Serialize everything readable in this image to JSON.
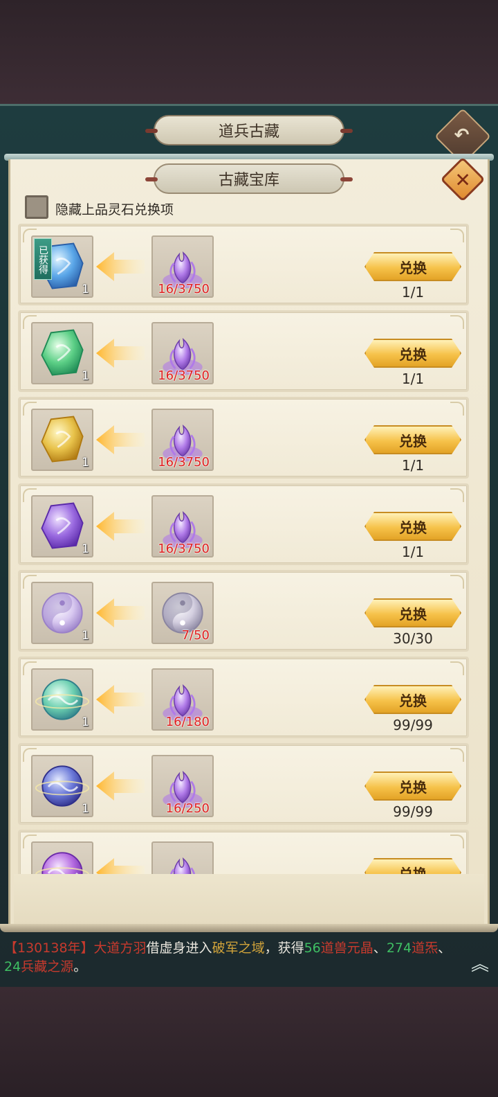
{
  "header": {
    "outer_title": "道兵古藏",
    "inner_title": "古藏宝库",
    "back_icon": "back-arrow-icon",
    "close_icon": "close-x-icon"
  },
  "filter": {
    "label": "隐藏上品灵石兑换项",
    "checked": false
  },
  "exchange_button_label": "兑换",
  "rows": [
    {
      "reward_icon": "blue-rune-crystal-icon",
      "reward_qty": "1",
      "obtained_label": "已获得",
      "cost_icon": "purple-flame-essence-icon",
      "cost_need": "16/3750",
      "limit": "1/1"
    },
    {
      "reward_icon": "green-rune-crystal-icon",
      "reward_qty": "1",
      "cost_icon": "purple-flame-essence-icon",
      "cost_need": "16/3750",
      "limit": "1/1"
    },
    {
      "reward_icon": "gold-rune-crystal-icon",
      "reward_qty": "1",
      "cost_icon": "purple-flame-essence-icon",
      "cost_need": "16/3750",
      "limit": "1/1"
    },
    {
      "reward_icon": "purple-rune-crystal-icon",
      "reward_qty": "1",
      "cost_icon": "purple-flame-essence-icon",
      "cost_need": "16/3750",
      "limit": "1/1"
    },
    {
      "reward_icon": "yin-yang-orb-icon",
      "reward_qty": "1",
      "cost_icon": "silver-yin-yang-orb-icon",
      "cost_need": "7/50",
      "limit": "30/30"
    },
    {
      "reward_icon": "teal-cloud-orb-icon",
      "reward_qty": "1",
      "cost_icon": "purple-flame-essence-icon",
      "cost_need": "16/180",
      "limit": "99/99"
    },
    {
      "reward_icon": "indigo-cloud-orb-icon",
      "reward_qty": "1",
      "cost_icon": "purple-flame-essence-icon",
      "cost_need": "16/250",
      "limit": "99/99"
    },
    {
      "reward_icon": "violet-cloud-orb-icon",
      "reward_qty": "",
      "cost_icon": "purple-flame-essence-icon",
      "cost_need": "",
      "limit": ""
    }
  ],
  "broadcast": {
    "year": "【130138年】",
    "player": "大道方羽",
    "text1": "借虚身进入",
    "place": "破军之域",
    "text2": "，获得",
    "n1": "56",
    "item1": "道兽元晶",
    "sep1": "、",
    "n2": "274",
    "item2": "道炁",
    "sep2": "、",
    "n3": "24",
    "item3": "兵藏之源",
    "end": "。"
  },
  "colors": {
    "need_red": "#e02020",
    "button_gold": "#f6c24a",
    "obtained_tag": "#2f8a75"
  }
}
